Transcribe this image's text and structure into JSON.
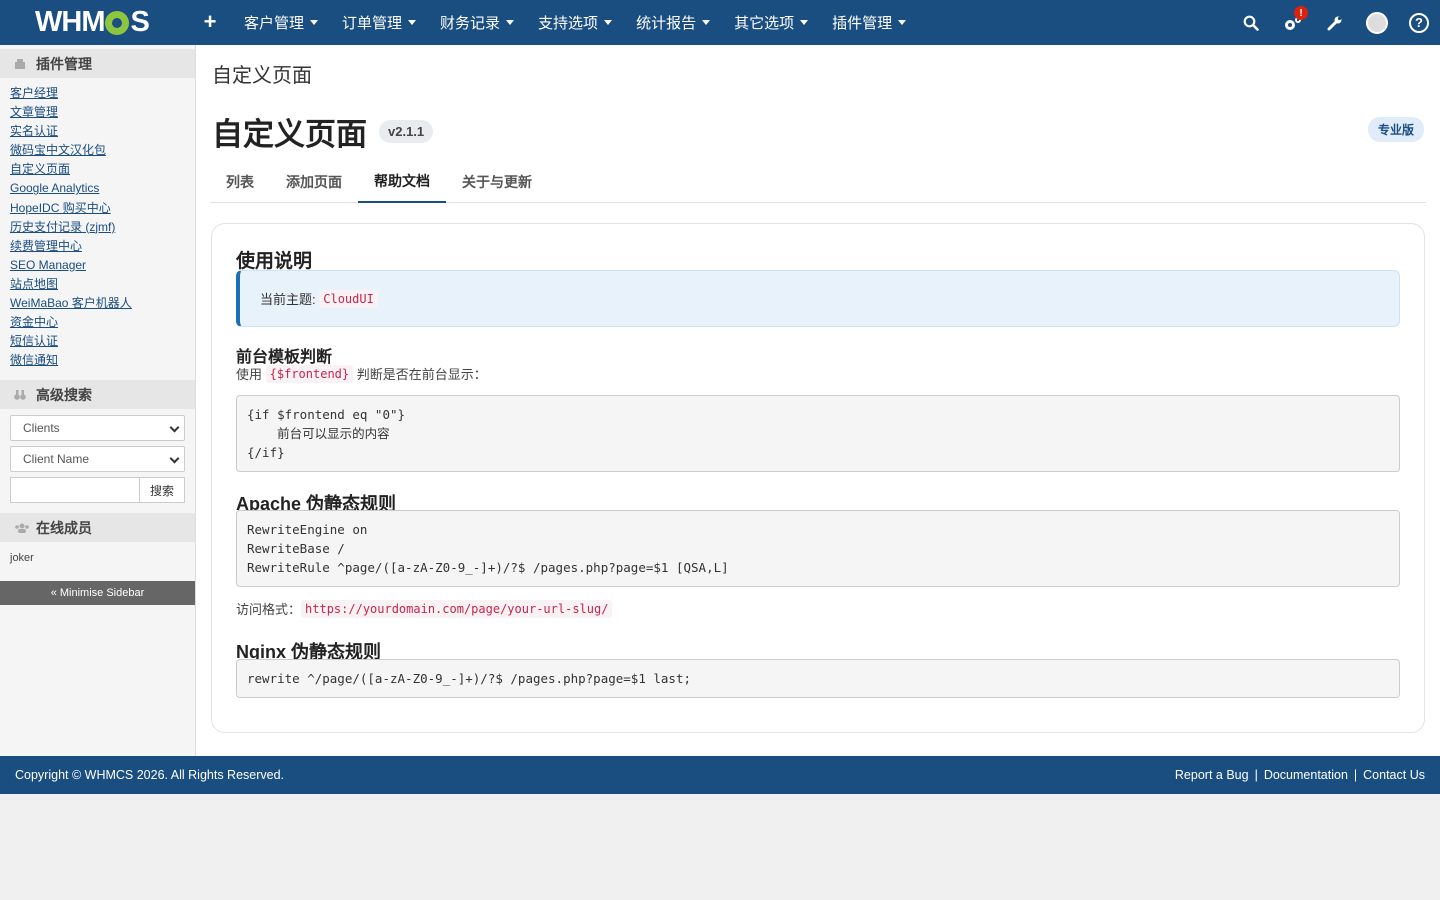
{
  "topbar": {
    "logo_text_1": "WHM",
    "logo_text_2": "S",
    "plus": "+",
    "nav": [
      "客户管理",
      "订单管理",
      "财务记录",
      "支持选项",
      "统计报告",
      "其它选项",
      "插件管理"
    ],
    "badge": "!",
    "help": "?"
  },
  "sidebar": {
    "addons_title": "插件管理",
    "links": [
      "客户经理",
      "文章管理",
      "实名认证",
      "微码宝中文汉化包",
      "自定义页面",
      "Google Analytics",
      "HopeIDC 购买中心",
      "历史支付记录 (zjmf)",
      "续费管理中心",
      "SEO Manager",
      "站点地图",
      "WeiMaBao 客户机器人",
      "资金中心",
      "短信认证",
      "微信通知"
    ],
    "search_title": "高级搜索",
    "select1": "Clients",
    "select2": "Client Name",
    "search_button": "搜索",
    "online_title": "在线成员",
    "online_user": "joker",
    "minimise": "« Minimise Sidebar"
  },
  "main": {
    "breadcrumb_title": "自定义页面",
    "title": "自定义页面",
    "version": "v2.1.1",
    "pro": "专业版",
    "tabs": [
      "列表",
      "添加页面",
      "帮助文档",
      "关于与更新"
    ],
    "usage_title": "使用说明",
    "theme_label": "当前主题:",
    "theme_value": "CloudUI",
    "frontend_title": "前台模板判断",
    "frontend_use": "使用",
    "frontend_var": "{$frontend}",
    "frontend_desc": "判断是否在前台显示：",
    "frontend_code": "{if $frontend eq \"0\"}\n    前台可以显示的内容\n{/if}",
    "apache_title": "Apache 伪静态规则",
    "apache_code": "RewriteEngine on\nRewriteBase /\nRewriteRule ^page/([a-zA-Z0-9_-]+)/?$ /pages.php?page=$1 [QSA,L]",
    "access_label": "访问格式：",
    "access_url": "https://yourdomain.com/page/your-url-slug/",
    "nginx_title": "Nginx 伪静态规则",
    "nginx_code": "rewrite ^/page/([a-zA-Z0-9_-]+)/?$ /pages.php?page=$1 last;"
  },
  "footer": {
    "copyright": "Copyright © WHMCS 2026. All Rights Reserved.",
    "links": [
      "Report a Bug",
      "Documentation",
      "Contact Us"
    ],
    "sep": "|"
  },
  "colors": {
    "brand": "#1a4d80",
    "accent_green": "#8cc63f",
    "code_red": "#c7254e"
  }
}
